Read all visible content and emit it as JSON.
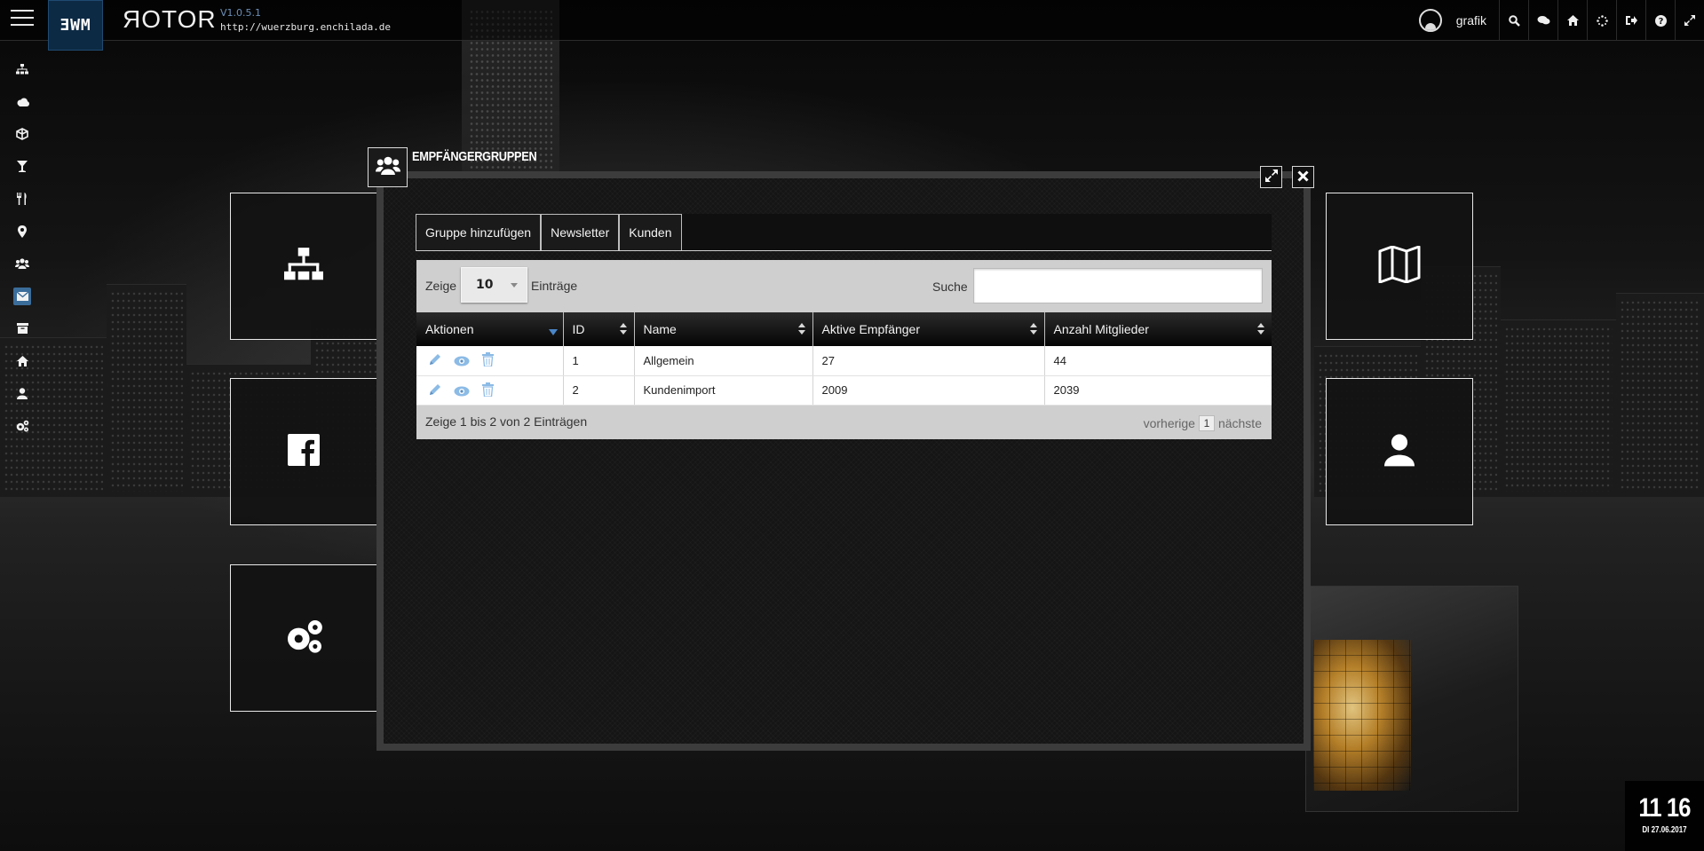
{
  "app": {
    "logo_text": "ƎWM",
    "brand": "ЯOTOR",
    "version": "V1.0.5.1",
    "url": "http://wuerzburg.enchilada.de",
    "accent_color": "#3b6d9b"
  },
  "topbar": {
    "username": "grafik",
    "icons": [
      "user-avatar-icon",
      "search-icon",
      "chat-icon",
      "home-icon",
      "spinner-icon",
      "logout-icon",
      "help-icon",
      "expand-icon"
    ]
  },
  "sidebar": {
    "items": [
      {
        "icon": "sitemap-icon"
      },
      {
        "icon": "cloud-icon"
      },
      {
        "icon": "cube-icon"
      },
      {
        "icon": "cocktail-icon"
      },
      {
        "icon": "cutlery-icon"
      },
      {
        "icon": "map-marker-icon"
      },
      {
        "icon": "users-icon"
      },
      {
        "icon": "envelope-icon",
        "active": true
      },
      {
        "icon": "archive-icon"
      },
      {
        "icon": "home-icon"
      },
      {
        "icon": "user-icon"
      },
      {
        "icon": "cogs-icon"
      }
    ]
  },
  "tiles": {
    "left": [
      "sitemap-icon",
      "facebook-icon",
      "cogs-icon"
    ],
    "right": [
      "map-icon",
      "user-icon"
    ]
  },
  "dialog": {
    "title": "EMPFÄNGERGRUPPEN",
    "header_icon": "users-icon",
    "tabs": [
      {
        "label": "Gruppe hinzufügen"
      },
      {
        "label": "Newsletter"
      },
      {
        "label": "Kunden"
      }
    ],
    "table": {
      "length_label_before": "Zeige",
      "length_value": "10",
      "length_label_after": "Einträge",
      "search_label": "Suche",
      "search_value": "",
      "columns": [
        "Aktionen",
        "ID",
        "Name",
        "Aktive Empfänger",
        "Anzahl Mitglieder"
      ],
      "rows": [
        {
          "id": "1",
          "name": "Allgemein",
          "active": "27",
          "members": "44"
        },
        {
          "id": "2",
          "name": "Kundenimport",
          "active": "2009",
          "members": "2039"
        }
      ],
      "info": "Zeige 1 bis 2 von 2 Einträgen",
      "pager_prev": "vorherige",
      "pager_page": "1",
      "pager_next": "nächste"
    }
  },
  "clock": {
    "time": "11 16",
    "date": "DI 27.06.2017"
  }
}
